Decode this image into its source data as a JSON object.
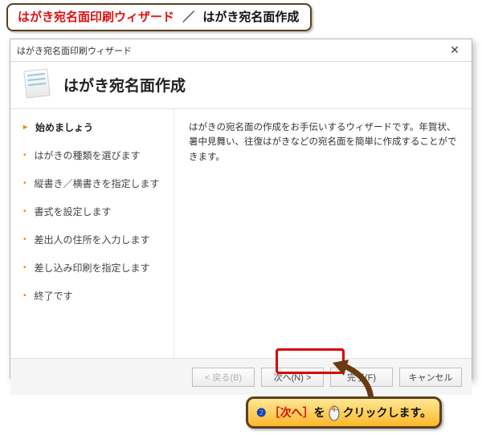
{
  "top_banner": {
    "red": "はがき宛名面印刷ウィザード",
    "sep": "／",
    "black": "はがき宛名面作成"
  },
  "dialog": {
    "title": "はがき宛名面印刷ウィザード",
    "close_glyph": "✕",
    "header": "はがき宛名面作成",
    "steps": [
      "始めましょう",
      "はがきの種類を選びます",
      "縦書き／横書きを指定します",
      "書式を設定します",
      "差出人の住所を入力します",
      "差し込み印刷を指定します",
      "終了です"
    ],
    "active_step_index": 0,
    "description": "はがきの宛名面の作成をお手伝いするウィザードです。年賀状、暑中見舞い、往復はがきなどの宛名面を簡単に作成することができます。",
    "buttons": {
      "back": "< 戻る(B)",
      "next": "次へ(N) >",
      "finish": "完了(F)",
      "cancel": "キャンセル"
    }
  },
  "bottom_banner": {
    "step_num": "❷",
    "bracket_open": "［",
    "red": "次へ",
    "bracket_close": "］",
    "mid": "を",
    "tail": "クリックします。"
  }
}
